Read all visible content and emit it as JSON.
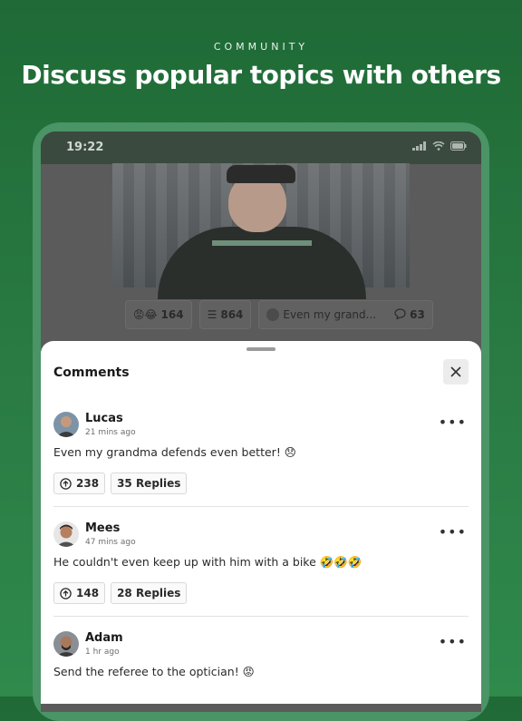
{
  "promo": {
    "eyebrow": "COMMUNITY",
    "headline": "Discuss popular topics with others"
  },
  "status_bar": {
    "time": "19:22"
  },
  "post_stats": {
    "reactions_count": "164",
    "comments_count": "864",
    "preview_text": "Even my grand...",
    "preview_replies": "63"
  },
  "comments_sheet": {
    "title": "Comments",
    "comments": [
      {
        "author": "Lucas",
        "time": "21 mins ago",
        "text": "Even my grandma defends even better! 😞",
        "upvotes": "238",
        "replies": "35 Replies"
      },
      {
        "author": "Mees",
        "time": "47 mins ago",
        "text": "He couldn't even keep up with him with a bike 🤣🤣🤣",
        "upvotes": "148",
        "replies": "28 Replies"
      },
      {
        "author": "Adam",
        "time": "1 hr ago",
        "text": "Send the referee to the optician! 😡"
      }
    ]
  },
  "colors": {
    "background": "#1f6a36",
    "accent": "#2f8a4c"
  }
}
